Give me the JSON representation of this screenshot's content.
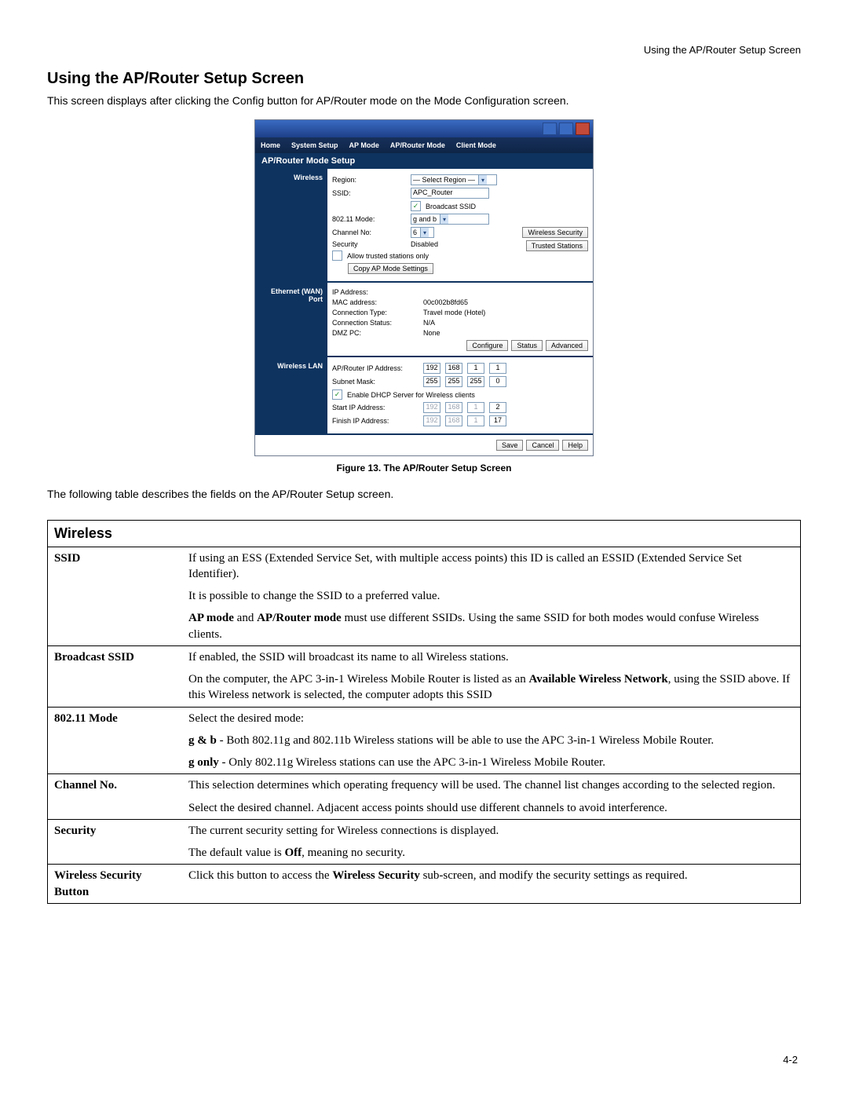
{
  "header_right": "Using the AP/Router Setup Screen",
  "section_title": "Using the AP/Router Setup Screen",
  "intro": "This screen displays after clicking the Config button for AP/Router mode on the Mode Configuration screen.",
  "menubar": [
    "Home",
    "System Setup",
    "AP Mode",
    "AP/Router Mode",
    "Client Mode"
  ],
  "setup_head": "AP/Router Mode Setup",
  "wireless": {
    "side": "Wireless",
    "region_label": "Region:",
    "region_value": "— Select Region —",
    "ssid_label": "SSID:",
    "ssid_value": "APC_Router",
    "broadcast_label": "Broadcast SSID",
    "mode_label": "802.11 Mode:",
    "mode_value": "g and b",
    "channel_label": "Channel No:",
    "channel_value": "6",
    "security_label": "Security",
    "security_value": "Disabled",
    "trusted_label": "Allow trusted stations only",
    "copy_btn": "Copy AP Mode Settings",
    "ws_btn": "Wireless Security",
    "ts_btn": "Trusted Stations"
  },
  "wan": {
    "side1": "Ethernet (WAN)",
    "side2": "Port",
    "ip_label": "IP Address:",
    "mac_label": "MAC address:",
    "mac_value": "00c002b8fd65",
    "ctype_label": "Connection Type:",
    "ctype_value": "Travel mode (Hotel)",
    "cstatus_label": "Connection Status:",
    "cstatus_value": "N/A",
    "dmz_label": "DMZ PC:",
    "dmz_value": "None",
    "configure_btn": "Configure",
    "status_btn": "Status",
    "advanced_btn": "Advanced"
  },
  "lan": {
    "side": "Wireless LAN",
    "ip_label": "AP/Router IP Address:",
    "ip": [
      "192",
      "168",
      "1",
      "1"
    ],
    "mask_label": "Subnet Mask:",
    "mask": [
      "255",
      "255",
      "255",
      "0"
    ],
    "dhcp_label": "Enable DHCP Server for Wireless clients",
    "start_label": "Start IP Address:",
    "start": [
      "192",
      "168",
      "1",
      "2"
    ],
    "finish_label": "Finish IP Address:",
    "finish": [
      "192",
      "168",
      "1",
      "17"
    ]
  },
  "save_btn": "Save",
  "cancel_btn": "Cancel",
  "help_btn": "Help",
  "fig_caption": "Figure 13. The AP/Router Setup Screen",
  "desc_para": "The following table describes the fields on the AP/Router Setup screen.",
  "table": {
    "group": "Wireless",
    "rows": [
      {
        "label": "SSID",
        "paras": [
          {
            "plain": "If using an ESS (Extended Service Set, with multiple access points) this ID is called an ESSID (Extended Service Set Identifier)."
          },
          {
            "plain": "It is possible to change the SSID to a preferred value."
          },
          {
            "html": "<b>AP mode</b> and <b>AP/Router mode</b> must use different SSIDs. Using the same SSID for both modes would confuse Wireless clients."
          }
        ]
      },
      {
        "label": "Broadcast SSID",
        "paras": [
          {
            "plain": "If enabled, the SSID will broadcast its name to all Wireless stations."
          },
          {
            "html": "On the computer, the APC 3-in-1 Wireless Mobile Router is listed as an <b>Available Wireless Network</b>, using the SSID above. If this Wireless network is selected, the computer adopts this SSID"
          }
        ]
      },
      {
        "label": "802.11 Mode",
        "paras": [
          {
            "plain": "Select the desired mode:"
          },
          {
            "html": "<b>g &amp; b</b> - Both 802.11g and 802.11b Wireless stations will be able to use the APC 3-in-1 Wireless Mobile Router."
          },
          {
            "html": "<b>g only</b> - Only 802.11g Wireless stations can use the APC 3-in-1 Wireless Mobile Router."
          }
        ]
      },
      {
        "label": "Channel No.",
        "paras": [
          {
            "plain": "This selection determines which operating frequency will be used. The channel list changes according to the selected region."
          },
          {
            "plain": "Select the desired channel. Adjacent access points should use different channels to avoid interference."
          }
        ]
      },
      {
        "label": "Security",
        "paras": [
          {
            "plain": "The current security setting for Wireless connections is displayed."
          },
          {
            "html": "The default value is <b>Off</b>, meaning no security."
          }
        ]
      },
      {
        "label": "Wireless Security Button",
        "paras": [
          {
            "html": "Click this button to access the <b>Wireless Security</b> sub-screen, and modify the security settings as required."
          }
        ]
      }
    ]
  },
  "page_num": "4-2"
}
